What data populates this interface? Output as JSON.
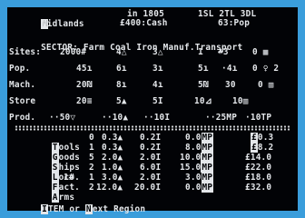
{
  "header": {
    "region": "Midlands",
    "year": "in 1805",
    "stats": "1SL 2TL 3DL",
    "cash": "£400:Cash",
    "pop": "63:Pop"
  },
  "sector_row": {
    "label": "SECTOR:",
    "farm": "Farm",
    "coal": "Coal",
    "iron": "Iron",
    "manuf": "Manuf.",
    "transport": "Transport"
  },
  "sites": {
    "label": "Sites:",
    "farm": "2000#",
    "coal": "4△",
    "iron": "3△",
    "manuf": "1",
    "manuf2": "♣3",
    "transport": "0 ▦"
  },
  "pop": {
    "label": "Pop.",
    "farm": "45ı",
    "coal": "6ı",
    "iron": "3ı",
    "manuf": "5ı",
    "manuf2": "·4ı",
    "transport": "0 ♀ 2"
  },
  "mach": {
    "label": "Mach.",
    "farm": "20₪",
    "coal": "8ı",
    "iron": "4ı",
    "manuf": "5₪",
    "manuf2": "30",
    "transport": "0 ▥"
  },
  "store": {
    "label": "Store",
    "farm": "20≡",
    "coal": "5▲",
    "iron": "5I",
    "manuf": "10⊿",
    "manuf2": "10▥",
    "transport": ""
  },
  "prod": {
    "label": "Prod.",
    "values": [
      "··50▽",
      "··10▲",
      "··10I",
      "··25MP",
      "·10TP"
    ]
  },
  "market": {
    "rows": [
      {
        "key": "T",
        "rest": "ools",
        "qty": "0",
        "a": "0.3▲",
        "b": "0.2I",
        "c": "0.0",
        "badge": "MP",
        "d": "0.3"
      },
      {
        "key": "G",
        "rest": "oods",
        "qty": "1",
        "a": "0.3▲",
        "b": "0.2I",
        "c": "8.0",
        "badge": "MP",
        "d": "8.2"
      },
      {
        "key": "S",
        "rest": "hips",
        "qty": "5",
        "a": "2.0▲",
        "b": "2.0I",
        "c": "10.0",
        "badge": "MP",
        "d": "14.0"
      },
      {
        "key": "L",
        "rest": "oco.",
        "qty": "2",
        "a": "1.0▲",
        "b": "6.0I",
        "c": "15.0",
        "badge": "MP",
        "d": "22.0"
      },
      {
        "key": "F",
        "rest": "act.",
        "qty": "1",
        "a": "3.0▲",
        "b": "2.0I",
        "c": "3.0",
        "badge": "MP",
        "d": "18.0"
      },
      {
        "key": "A",
        "rest": "rms",
        "qty": "2",
        "a": "12.0▲",
        "b": "20.0I",
        "c": "0.0",
        "badge": "MP",
        "d": "32.0"
      }
    ],
    "factory_tag": "1#"
  },
  "prompt": {
    "i": "I",
    "item_rest": "TEM or ",
    "n": "N",
    "next_rest": "ext Region"
  }
}
